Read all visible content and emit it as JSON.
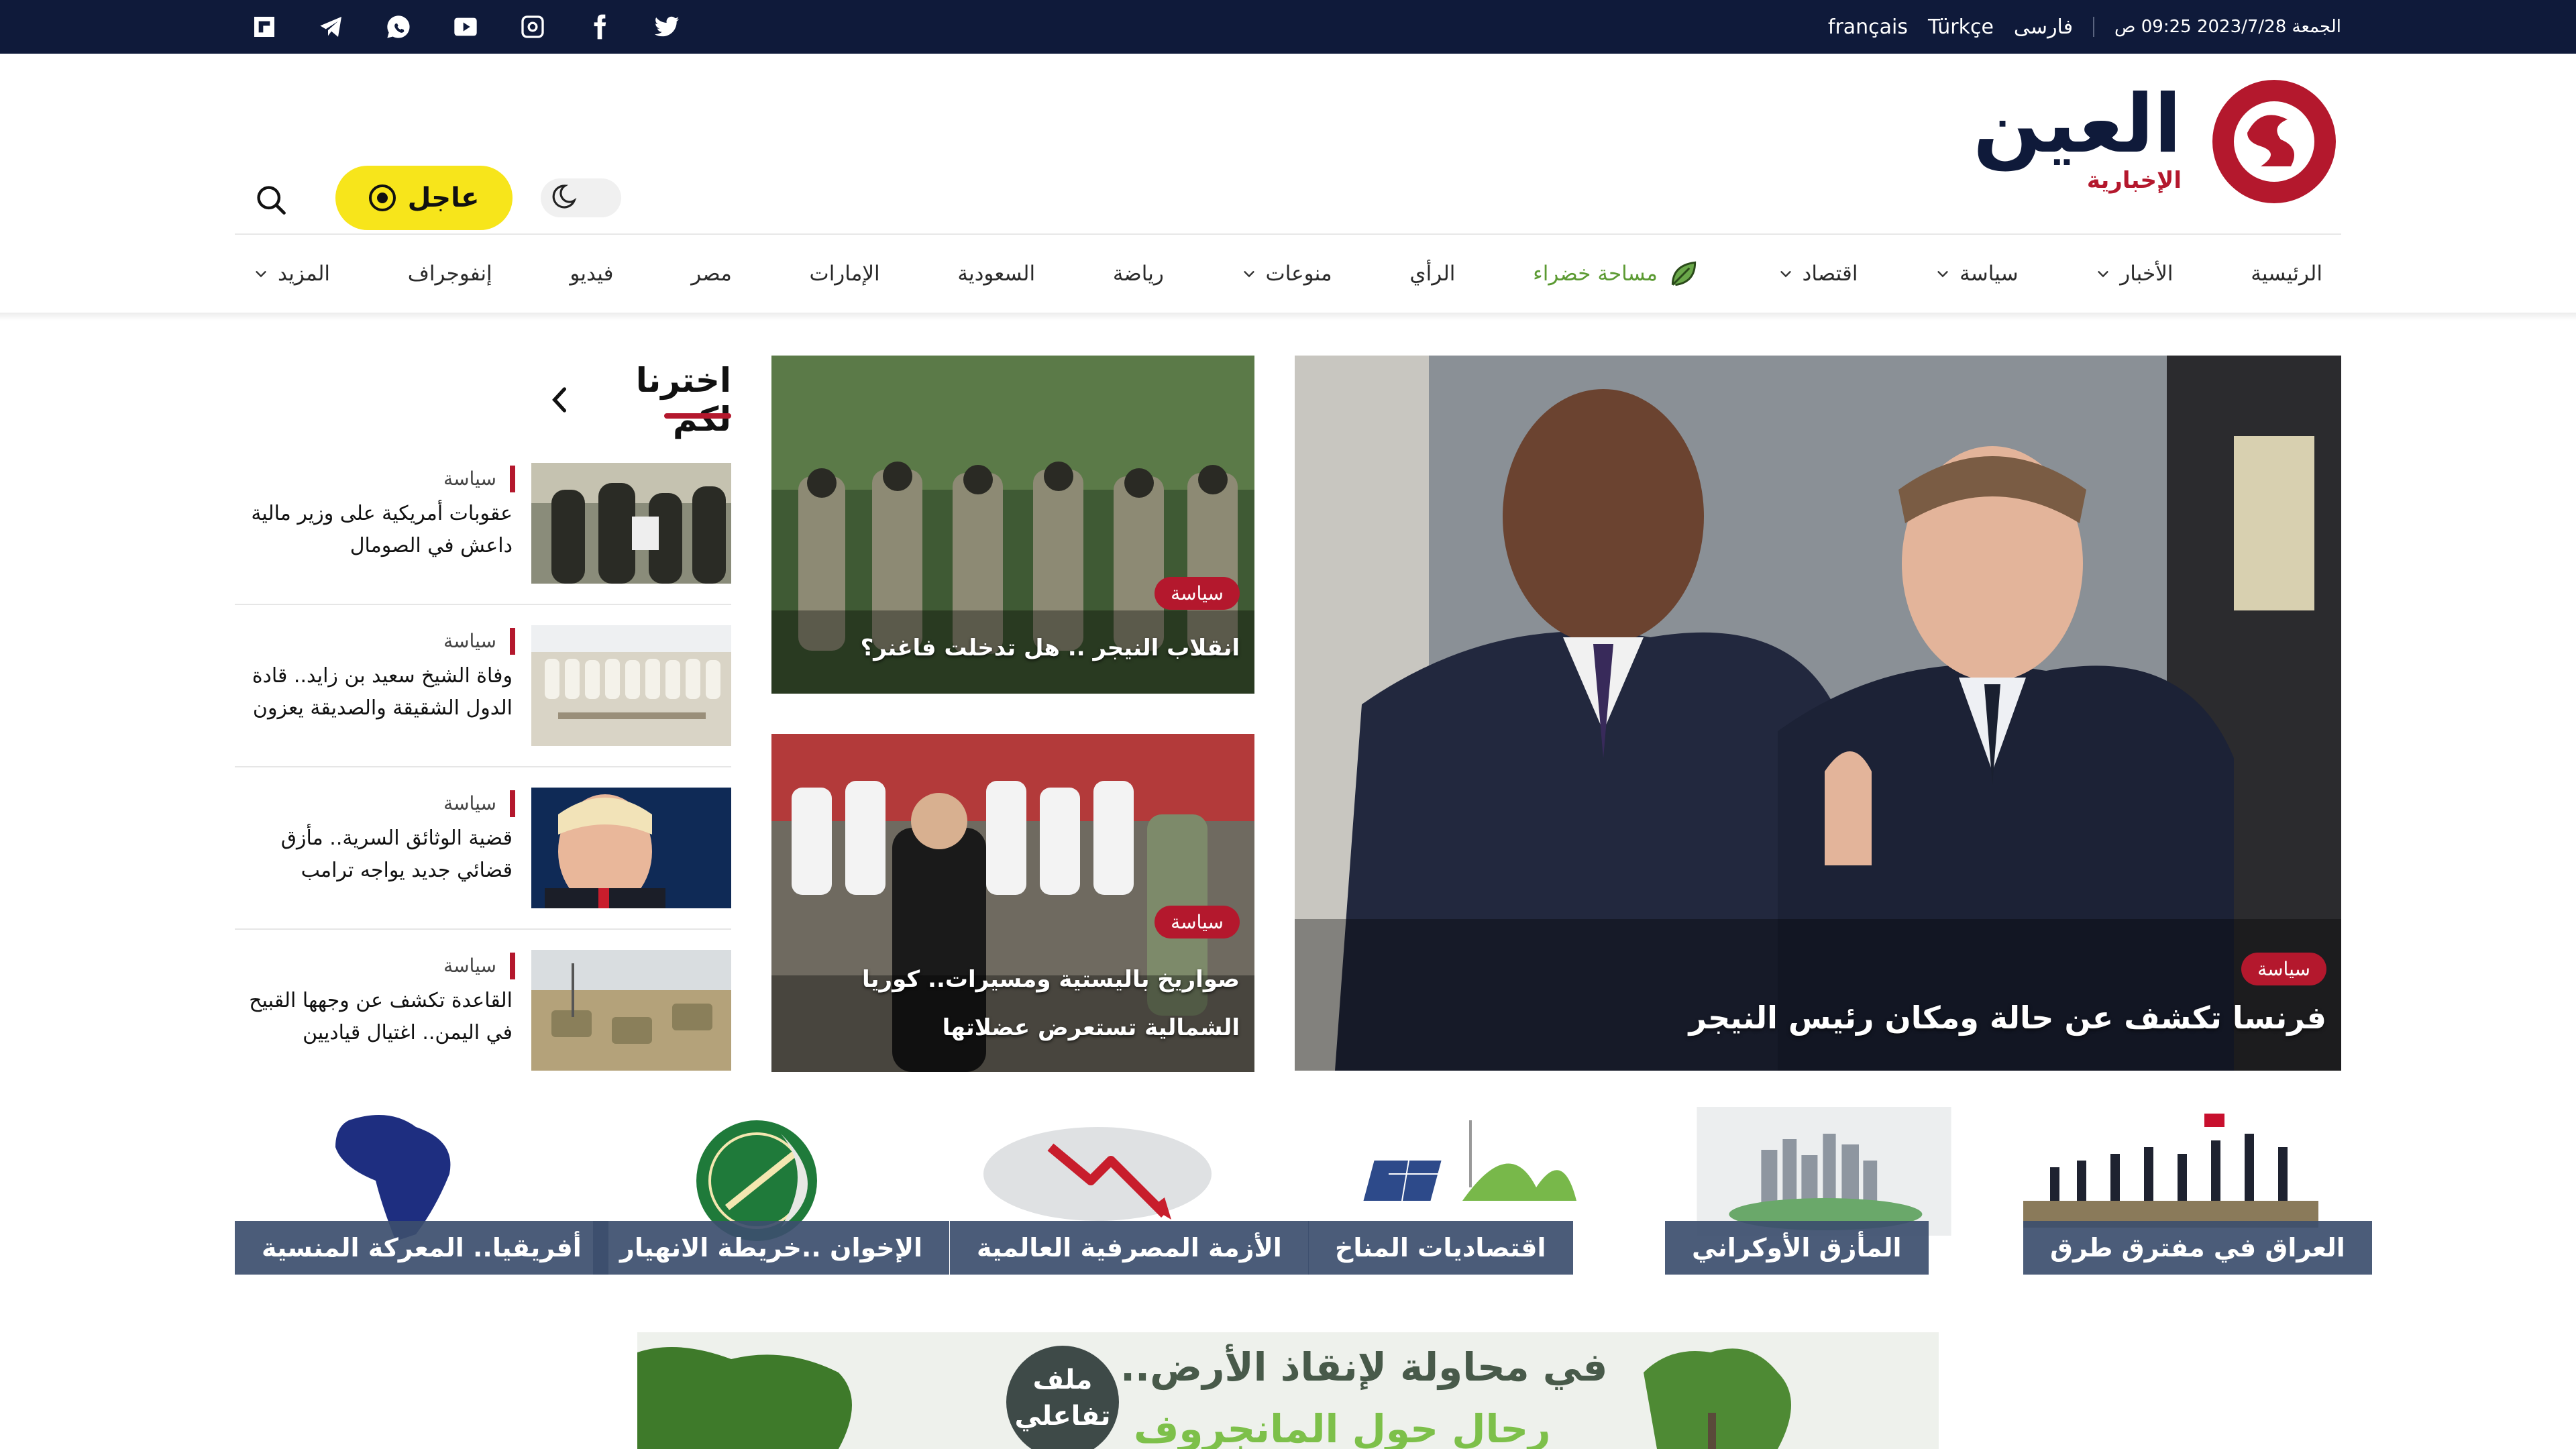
{
  "topbar": {
    "date": "الجمعة 2023/7/28 09:25 ص",
    "languages": [
      "فارسی",
      "Türkçe",
      "français"
    ],
    "socials": [
      "flipboard-icon",
      "telegram-icon",
      "whatsapp-icon",
      "youtube-icon",
      "instagram-icon",
      "facebook-icon",
      "twitter-icon"
    ]
  },
  "header": {
    "logo_main": "العين",
    "logo_sub": "الإخبارية",
    "breaking_label": "عاجل",
    "brand_color": "#b4182d",
    "accent_yellow": "#f7e51b",
    "dark_navy": "#0f1a3a"
  },
  "nav": {
    "items": [
      {
        "label": "الرئيسية",
        "dropdown": false
      },
      {
        "label": "الأخبار",
        "dropdown": true
      },
      {
        "label": "سياسة",
        "dropdown": true
      },
      {
        "label": "اقتصاد",
        "dropdown": true
      },
      {
        "label": "مساحة خضراء",
        "dropdown": false,
        "green": true
      },
      {
        "label": "الرأي",
        "dropdown": false
      },
      {
        "label": "منوعات",
        "dropdown": true
      },
      {
        "label": "رياضة",
        "dropdown": false
      },
      {
        "label": "السعودية",
        "dropdown": false
      },
      {
        "label": "الإمارات",
        "dropdown": false
      },
      {
        "label": "مصر",
        "dropdown": false
      },
      {
        "label": "فيديو",
        "dropdown": false
      },
      {
        "label": "إنفوجراف",
        "dropdown": false
      },
      {
        "label": "المزيد",
        "dropdown": true
      }
    ]
  },
  "hero": {
    "category": "سياسة",
    "title": "فرنسا تكشف عن حالة ومكان رئيس النيجر"
  },
  "mid_cards": [
    {
      "category": "سياسة",
      "title": "انقلاب النيجر .. هل تدخلت فاغنر؟"
    },
    {
      "category": "سياسة",
      "title": "صواريخ باليستية ومسيرات.. كوريا الشمالية تستعرض عضلاتها"
    }
  ],
  "picks": {
    "heading": "اخترنا لكم",
    "items": [
      {
        "category": "سياسة",
        "title": "عقوبات أمريكية على وزير مالية داعش في الصومال"
      },
      {
        "category": "سياسة",
        "title": "وفاة الشيخ سعيد بن زايد.. قادة الدول الشقيقة والصديقة يعزون"
      },
      {
        "category": "سياسة",
        "title": "قضية الوثائق السرية.. مأزق قضائي جديد يواجه ترامب"
      },
      {
        "category": "سياسة",
        "title": "القاعدة تكشف عن وجهها القبيح في اليمن.. اغتيال قياديين"
      }
    ]
  },
  "topics": [
    {
      "label": "العراق في مفترق طرق"
    },
    {
      "label": "المأزق الأوكراني"
    },
    {
      "label": "اقتصاديات المناخ"
    },
    {
      "label": "الأزمة المصرفية العالمية"
    },
    {
      "label": "الإخوان ..خريطة الانهيار"
    },
    {
      "label": "أفريقيا.. المعركة المنسية"
    }
  ],
  "banner": {
    "line1": "في محاولة لإنقاذ الأرض..",
    "line2": "رحال حول المانجروف",
    "badge": "ملف تفاعلي"
  }
}
